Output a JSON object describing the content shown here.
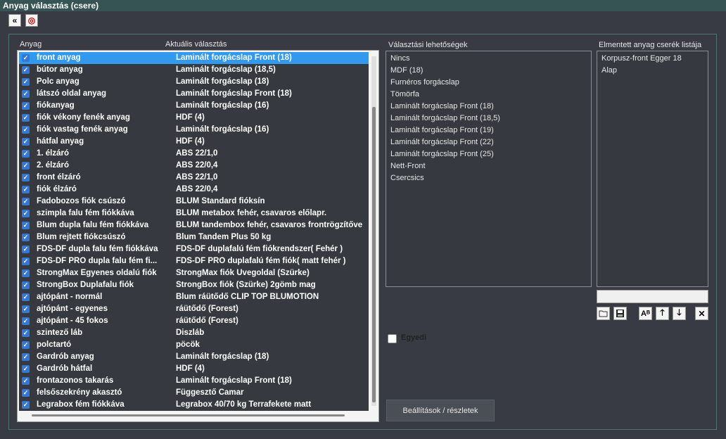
{
  "window": {
    "title": "Anyag választás (csere)"
  },
  "toolbar": {
    "back_glyph": "«",
    "help_glyph": "◎"
  },
  "headers": {
    "material": "Anyag",
    "current": "Aktuális választás",
    "options": "Választási lehetőségek",
    "saved": "Elmentett anyag cserék listája"
  },
  "rows": [
    {
      "anyag": "front anyag",
      "aktualis": "Laminált forgácslap Front (18)"
    },
    {
      "anyag": "bútor anyag",
      "aktualis": "Laminált forgácslap (18,5)"
    },
    {
      "anyag": "Polc anyag",
      "aktualis": "Laminált forgácslap (18)"
    },
    {
      "anyag": "látszó oldal anyag",
      "aktualis": "Laminált forgácslap Front (18)"
    },
    {
      "anyag": "fiókanyag",
      "aktualis": "Laminált forgácslap (16)"
    },
    {
      "anyag": "fiók vékony fenék anyag",
      "aktualis": "HDF (4)"
    },
    {
      "anyag": "fiók vastag fenék anyag",
      "aktualis": "Laminált forgácslap (16)"
    },
    {
      "anyag": "hátfal anyag",
      "aktualis": "HDF (4)"
    },
    {
      "anyag": "1. élzáró",
      "aktualis": "ABS 22/1,0"
    },
    {
      "anyag": "2. élzáró",
      "aktualis": "ABS 22/0,4"
    },
    {
      "anyag": "front élzáró",
      "aktualis": "ABS 22/1,0"
    },
    {
      "anyag": "fiók élzáró",
      "aktualis": "ABS 22/0,4"
    },
    {
      "anyag": "Fadobozos fiók csúszó",
      "aktualis": "BLUM Standard fióksín"
    },
    {
      "anyag": "szimpla falu fém fiókkáva",
      "aktualis": "BLUM metabox fehér, csavaros előlapr."
    },
    {
      "anyag": "Blum dupla falu fém fiókkáva",
      "aktualis": "BLUM tandembox fehér, csavaros frontrögzítőve"
    },
    {
      "anyag": "Blum rejtett fiókcsúszó",
      "aktualis": "Blum Tandem Plus 50 kg"
    },
    {
      "anyag": "FDS-DF dupla falu fém fiókkáva",
      "aktualis": "FDS-DF duplafalú fém fiókrendszer( Fehér )"
    },
    {
      "anyag": "FDS-DF PRO dupla falu fém fi...",
      "aktualis": "FDS-DF PRO duplafalú fém fiók( matt fehér )"
    },
    {
      "anyag": "StrongMax Egyenes oldalú fiók",
      "aktualis": "StrongMax  fiók Üvegoldal (Szürke)"
    },
    {
      "anyag": "StrongBox Duplafalu fiók",
      "aktualis": "StrongBox fiók (Szürke) 2gömb mag"
    },
    {
      "anyag": "ajtópánt - normál",
      "aktualis": "Blum ráütődő CLIP TOP BLUMOTION"
    },
    {
      "anyag": "ajtópánt - egyenes",
      "aktualis": "ráütődő (Forest)"
    },
    {
      "anyag": "ajtópánt - 45 fokos",
      "aktualis": "ráütődő (Forest)"
    },
    {
      "anyag": "szintező láb",
      "aktualis": "Diszláb"
    },
    {
      "anyag": "polctartó",
      "aktualis": "pöcök"
    },
    {
      "anyag": "Gardrób anyag",
      "aktualis": "Laminált forgácslap (18)"
    },
    {
      "anyag": "Gardrób hátfal",
      "aktualis": "HDF (4)"
    },
    {
      "anyag": "frontazonos takarás",
      "aktualis": "Laminált forgácslap Front (18)"
    },
    {
      "anyag": "felsőszekrény akasztó",
      "aktualis": "Függesztő Camar"
    },
    {
      "anyag": "Legrabox fém fiókkáva",
      "aktualis": "Legrabox 40/70 kg Terrafekete matt"
    }
  ],
  "options": [
    "Nincs",
    "MDF (18)",
    "Furnéros forgácslap",
    "Tömörfa",
    "Laminált forgácslap Front (18)",
    "Laminált forgácslap Front (18,5)",
    "Laminált forgácslap Front (19)",
    "Laminált forgácslap Front (22)",
    "Laminált forgácslap Front (25)",
    "Nett-Front",
    "Csercsics"
  ],
  "saved": [
    "Korpusz-front Egger 18",
    "Alap"
  ],
  "actions": {
    "ab_glyph": "Aᴮ",
    "up_glyph": "🡑",
    "down_glyph": "🡓",
    "delete_glyph": "✕"
  },
  "checkbox": {
    "label": "Egyedi"
  },
  "settings_button": "Beállítások / részletek",
  "colors": {
    "accent": "#3299ee",
    "title_bar": "#365454",
    "background": "#383b44"
  }
}
